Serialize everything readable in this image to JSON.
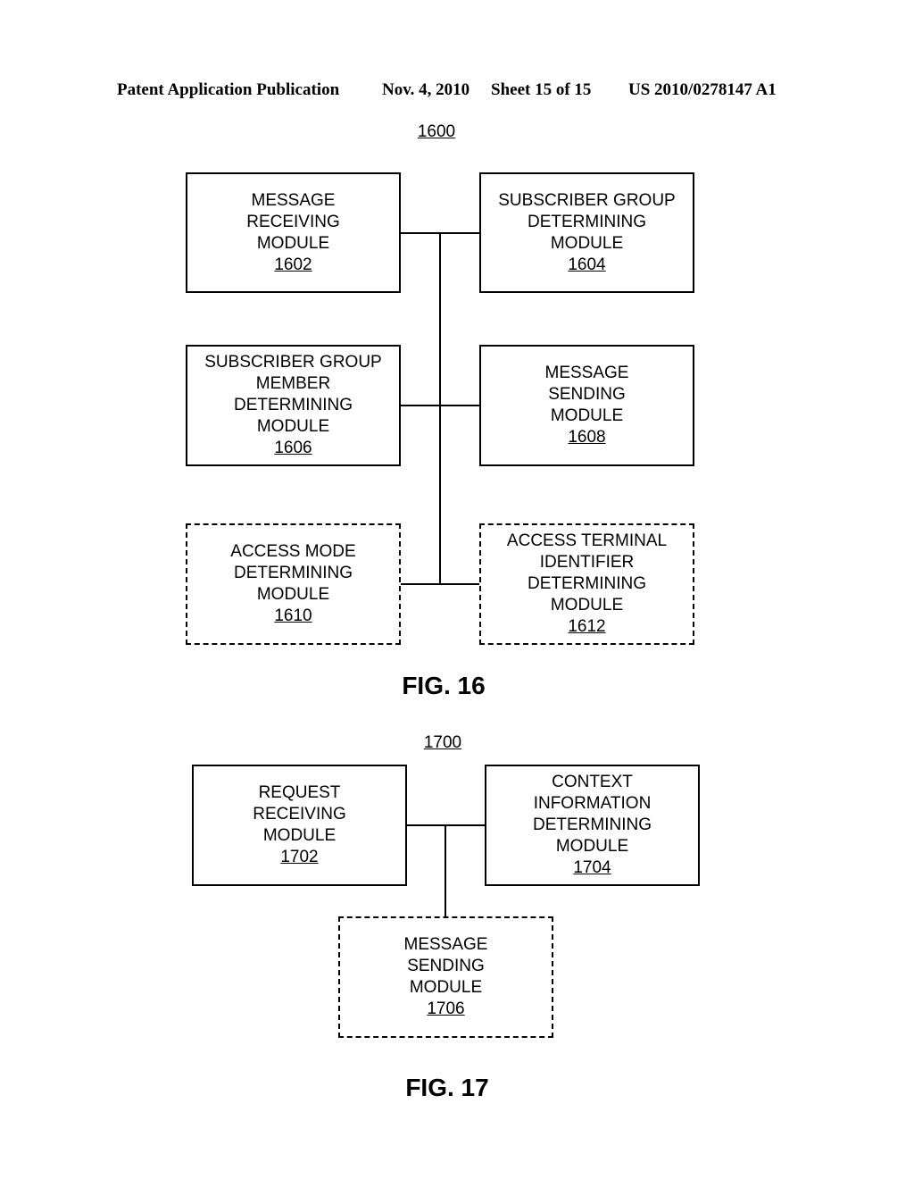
{
  "header": {
    "publication": "Patent Application Publication",
    "date": "Nov. 4, 2010",
    "sheet": "Sheet 15 of 15",
    "number": "US 2010/0278147 A1"
  },
  "fig16": {
    "ref": "1600",
    "caption": "FIG. 16",
    "modules": [
      {
        "lines": [
          "MESSAGE",
          "RECEIVING",
          "MODULE"
        ],
        "num": "1602",
        "style": "solid"
      },
      {
        "lines": [
          "SUBSCRIBER GROUP",
          "DETERMINING",
          "MODULE"
        ],
        "num": "1604",
        "style": "solid"
      },
      {
        "lines": [
          "SUBSCRIBER GROUP",
          "MEMBER",
          "DETERMINING",
          "MODULE"
        ],
        "num": "1606",
        "style": "solid"
      },
      {
        "lines": [
          "MESSAGE",
          "SENDING",
          "MODULE"
        ],
        "num": "1608",
        "style": "solid"
      },
      {
        "lines": [
          "ACCESS MODE",
          "DETERMINING",
          "MODULE"
        ],
        "num": "1610",
        "style": "dashed"
      },
      {
        "lines": [
          "ACCESS TERMINAL",
          "IDENTIFIER",
          "DETERMINING",
          "MODULE"
        ],
        "num": "1612",
        "style": "dashed"
      }
    ]
  },
  "fig17": {
    "ref": "1700",
    "caption": "FIG. 17",
    "modules": [
      {
        "lines": [
          "REQUEST",
          "RECEIVING",
          "MODULE"
        ],
        "num": "1702",
        "style": "solid"
      },
      {
        "lines": [
          "CONTEXT",
          "INFORMATION",
          "DETERMINING",
          "MODULE"
        ],
        "num": "1704",
        "style": "solid"
      },
      {
        "lines": [
          "MESSAGE",
          "SENDING",
          "MODULE"
        ],
        "num": "1706",
        "style": "dashed"
      }
    ]
  }
}
